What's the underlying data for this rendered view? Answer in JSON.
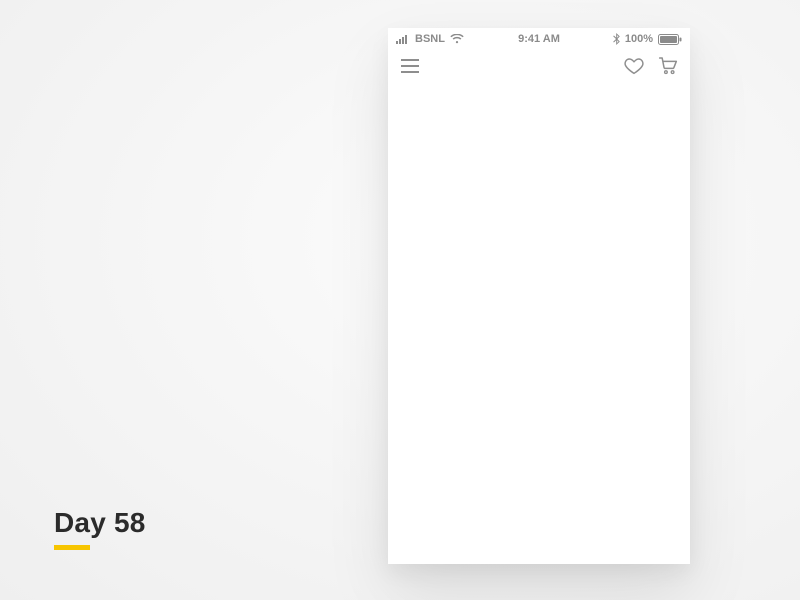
{
  "page": {
    "day_label": "Day 58",
    "underline_color": "#f7c500"
  },
  "statusbar": {
    "carrier": "BSNL",
    "time": "9:41 AM",
    "battery_pct": "100%"
  },
  "nav": {
    "menu_icon": "hamburger-icon",
    "heart_icon": "heart-icon",
    "cart_icon": "cart-icon"
  }
}
